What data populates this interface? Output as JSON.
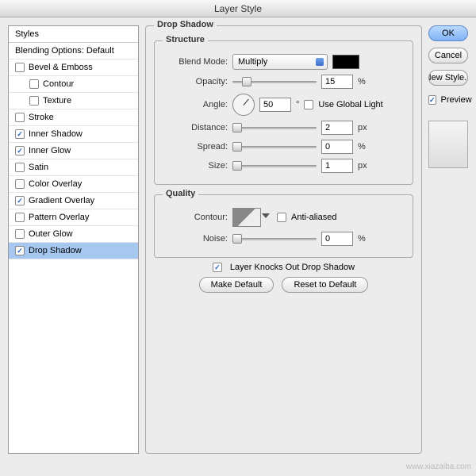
{
  "window": {
    "title": "Layer Style"
  },
  "sidebar": {
    "header": "Styles",
    "blending": "Blending Options: Default",
    "items": [
      {
        "label": "Bevel & Emboss",
        "checked": false,
        "indent": false
      },
      {
        "label": "Contour",
        "checked": false,
        "indent": true
      },
      {
        "label": "Texture",
        "checked": false,
        "indent": true
      },
      {
        "label": "Stroke",
        "checked": false,
        "indent": false
      },
      {
        "label": "Inner Shadow",
        "checked": true,
        "indent": false
      },
      {
        "label": "Inner Glow",
        "checked": true,
        "indent": false
      },
      {
        "label": "Satin",
        "checked": false,
        "indent": false
      },
      {
        "label": "Color Overlay",
        "checked": false,
        "indent": false
      },
      {
        "label": "Gradient Overlay",
        "checked": true,
        "indent": false
      },
      {
        "label": "Pattern Overlay",
        "checked": false,
        "indent": false
      },
      {
        "label": "Outer Glow",
        "checked": false,
        "indent": false
      },
      {
        "label": "Drop Shadow",
        "checked": true,
        "indent": false,
        "selected": true
      }
    ]
  },
  "main": {
    "title": "Drop Shadow",
    "structure": {
      "legend": "Structure",
      "blendMode": {
        "label": "Blend Mode:",
        "value": "Multiply",
        "color": "#000000"
      },
      "opacity": {
        "label": "Opacity:",
        "value": "15",
        "unit": "%",
        "pos": 15
      },
      "angle": {
        "label": "Angle:",
        "value": "50",
        "unit": "°",
        "globalLabel": "Use Global Light",
        "globalChecked": false
      },
      "distance": {
        "label": "Distance:",
        "value": "2",
        "unit": "px",
        "pos": 2
      },
      "spread": {
        "label": "Spread:",
        "value": "0",
        "unit": "%",
        "pos": 0
      },
      "size": {
        "label": "Size:",
        "value": "1",
        "unit": "px",
        "pos": 1
      }
    },
    "quality": {
      "legend": "Quality",
      "contour": {
        "label": "Contour:",
        "antiLabel": "Anti-aliased",
        "antiChecked": false
      },
      "noise": {
        "label": "Noise:",
        "value": "0",
        "unit": "%",
        "pos": 0
      }
    },
    "knockout": {
      "label": "Layer Knocks Out Drop Shadow",
      "checked": true
    },
    "buttons": {
      "makeDefault": "Make Default",
      "resetDefault": "Reset to Default"
    }
  },
  "side": {
    "ok": "OK",
    "cancel": "Cancel",
    "newStyle": "New Style...",
    "preview": {
      "label": "Preview",
      "checked": true
    }
  },
  "watermark": "www.xiazaiba.com"
}
